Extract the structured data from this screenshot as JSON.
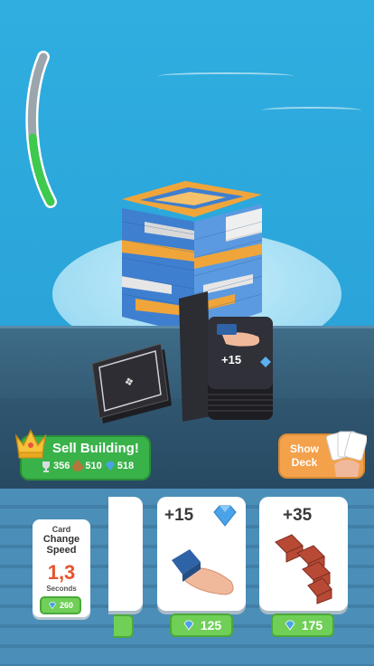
{
  "progress": {
    "fill_fraction": 0.45,
    "fill_color": "#3ec94f",
    "track_color": "#9aa6ac"
  },
  "deck": {
    "top_label": "+15"
  },
  "sell": {
    "title": "Sell Building!",
    "trophies": "356",
    "coins": "510",
    "gems": "518"
  },
  "show_deck": {
    "label": "Show Deck"
  },
  "speed": {
    "line1": "Card",
    "line2": "Change Speed",
    "value": "1,3",
    "unit": "Seconds",
    "price": "260"
  },
  "offers": [
    {
      "amount": "+15",
      "icon": "gem-icon",
      "price": "125"
    },
    {
      "amount": "+35",
      "icon": "bricks-icon",
      "price": "175"
    }
  ],
  "colors": {
    "gem": "#4aa3e8",
    "green_button": "#6fcf57",
    "orange_button": "#f3a14b",
    "sell_panel": "#39b24a"
  }
}
